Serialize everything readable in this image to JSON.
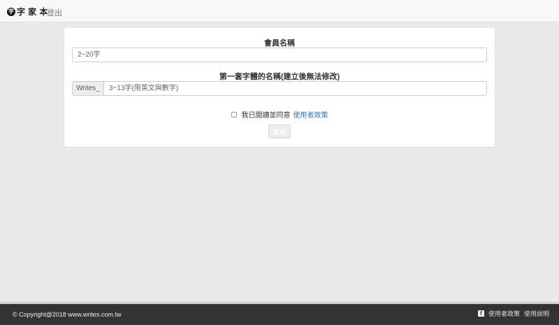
{
  "navbar": {
    "logo_mark": "字",
    "logo_text": "字 家 本",
    "logout_label": "登出"
  },
  "form": {
    "member_name_label": "會員名稱",
    "member_name_placeholder": "2~20字",
    "font_name_label": "第一套字體的名稱(建立後無法修改)",
    "font_prefix": "Writes_",
    "font_name_placeholder": "3~13字(限英文與數字)",
    "agree_text": "我已閱讀並同意",
    "policy_link": "使用者政策",
    "confirm_label": "確認"
  },
  "footer": {
    "copyright": "© Copyright@2018 www.writes.com.tw",
    "fb_icon": "f",
    "link_terms": "使用者政策",
    "link_use": "使用說明"
  },
  "colors": {
    "link": "#337ab7",
    "footer_bg": "#333333",
    "page_bg": "#e9e9e9"
  }
}
